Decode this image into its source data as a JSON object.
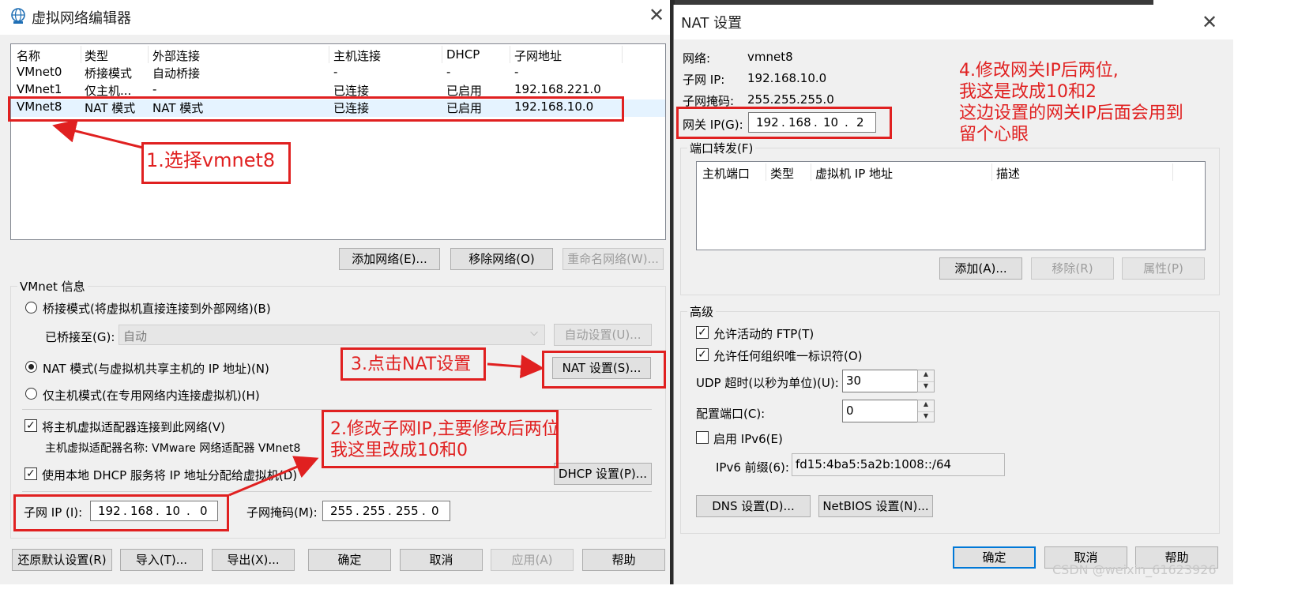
{
  "left": {
    "title": "虚拟网络编辑器",
    "table": {
      "headers": [
        "名称",
        "类型",
        "外部连接",
        "主机连接",
        "DHCP",
        "子网地址"
      ],
      "rows": [
        [
          "VMnet0",
          "桥接模式",
          "自动桥接",
          "-",
          "-",
          "-"
        ],
        [
          "VMnet1",
          "仅主机...",
          "-",
          "已连接",
          "已启用",
          "192.168.221.0"
        ],
        [
          "VMnet8",
          "NAT 模式",
          "NAT 模式",
          "已连接",
          "已启用",
          "192.168.10.0"
        ]
      ]
    },
    "add_network": "添加网络(E)...",
    "remove_network": "移除网络(O)",
    "rename_network": "重命名网络(W)...",
    "vmnet_info": "VMnet 信息",
    "bridged_mode": "桥接模式(将虚拟机直接连接到外部网络)(B)",
    "bridged_to_label": "已桥接至(G):",
    "bridged_to_value": "自动",
    "auto_settings": "自动设置(U)...",
    "nat_mode": "NAT 模式(与虚拟机共享主机的 IP 地址)(N)",
    "nat_settings": "NAT 设置(S)...",
    "host_only": "仅主机模式(在专用网络内连接虚拟机)(H)",
    "connect_adapter": "将主机虚拟适配器连接到此网络(V)",
    "adapter_name": "主机虚拟适配器名称: VMware 网络适配器 VMnet8",
    "use_dhcp": "使用本地 DHCP 服务将 IP 地址分配给虚拟机(D)",
    "dhcp_settings": "DHCP 设置(P)...",
    "subnet_ip_label": "子网 IP (I):",
    "subnet_ip": [
      "192",
      "168",
      "10",
      "0"
    ],
    "subnet_mask_label": "子网掩码(M):",
    "subnet_mask": [
      "255",
      "255",
      "255",
      "0"
    ],
    "restore_defaults": "还原默认设置(R)",
    "import": "导入(T)...",
    "export": "导出(X)...",
    "ok": "确定",
    "cancel": "取消",
    "apply": "应用(A)",
    "help": "帮助"
  },
  "right": {
    "title": "NAT 设置",
    "network_label": "网络:",
    "network_value": "vmnet8",
    "subnet_ip_label": "子网 IP:",
    "subnet_ip_value": "192.168.10.0",
    "subnet_mask_label": "子网掩码:",
    "subnet_mask_value": "255.255.255.0",
    "gateway_label": "网关 IP(G):",
    "gateway_ip": [
      "192",
      "168",
      "10",
      "2"
    ],
    "port_forwarding": "端口转发(F)",
    "pf_headers": [
      "主机端口",
      "类型",
      "虚拟机 IP 地址",
      "描述"
    ],
    "add": "添加(A)...",
    "remove": "移除(R)",
    "properties": "属性(P)",
    "advanced": "高级",
    "allow_ftp": "允许活动的 FTP(T)",
    "allow_org_id": "允许任何组织唯一标识符(O)",
    "udp_timeout_label": "UDP 超时(以秒为单位)(U):",
    "udp_timeout": "30",
    "config_port_label": "配置端口(C):",
    "config_port": "0",
    "enable_ipv6": "启用 IPv6(E)",
    "ipv6_prefix_label": "IPv6 前缀(6):",
    "ipv6_prefix": "fd15:4ba5:5a2b:1008::/64",
    "dns_settings": "DNS 设置(D)...",
    "netbios_settings": "NetBIOS 设置(N)...",
    "ok": "确定",
    "cancel": "取消",
    "help": "帮助"
  },
  "annotations": {
    "step1": "1.选择vmnet8",
    "step2_line1": "2.修改子网IP,主要修改后两位",
    "step2_line2": "我这里改成10和0",
    "step3": "3.点击NAT设置",
    "step4_line1": "4.修改网关IP后两位,",
    "step4_line2": "我这是改成10和2",
    "step4_line3": "这边设置的网关IP后面会用到",
    "step4_line4": "留个心眼"
  },
  "watermark": "CSDN @weixin_61623926",
  "colors": {
    "annotation_red": "#e02020",
    "focus_blue": "#0078d7"
  }
}
